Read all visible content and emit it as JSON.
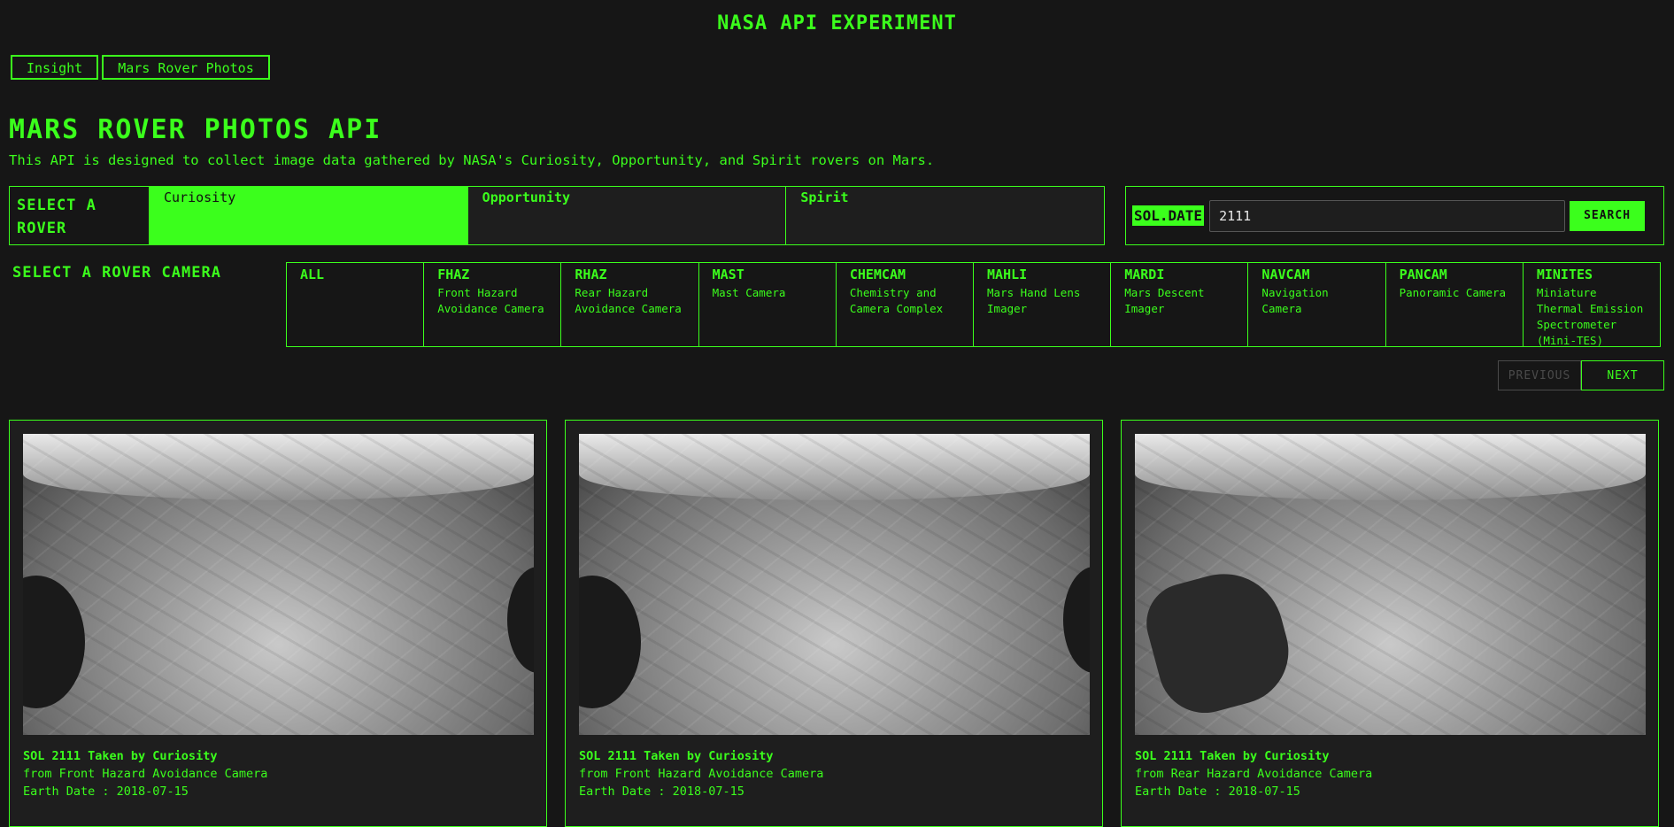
{
  "app_title": "NASA API EXPERIMENT",
  "nav": [
    "Insight",
    "Mars Rover Photos"
  ],
  "page": {
    "title": "MARS ROVER PHOTOS API",
    "description": "This API is designed to collect image data gathered by NASA's Curiosity, Opportunity, and Spirit rovers on Mars."
  },
  "rover_select": {
    "label": "SELECT A ROVER",
    "options": [
      "Curiosity",
      "Opportunity",
      "Spirit"
    ],
    "selected": "Curiosity"
  },
  "search": {
    "label": "SOL.DATE",
    "value": "2111",
    "button": "SEARCH"
  },
  "camera_select": {
    "label": "SELECT A ROVER CAMERA",
    "cameras": [
      {
        "code": "ALL",
        "name": ""
      },
      {
        "code": "FHAZ",
        "name": "Front Hazard Avoidance Camera"
      },
      {
        "code": "RHAZ",
        "name": "Rear Hazard Avoidance Camera"
      },
      {
        "code": "MAST",
        "name": "Mast Camera"
      },
      {
        "code": "CHEMCAM",
        "name": "Chemistry and Camera Complex"
      },
      {
        "code": "MAHLI",
        "name": "Mars Hand Lens Imager"
      },
      {
        "code": "MARDI",
        "name": "Mars Descent Imager"
      },
      {
        "code": "NAVCAM",
        "name": "Navigation Camera"
      },
      {
        "code": "PANCAM",
        "name": "Panoramic Camera"
      },
      {
        "code": "MINITES",
        "name": "Miniature Thermal Emission Spectrometer (Mini-TES)"
      }
    ]
  },
  "pagination": {
    "previous": "PREVIOUS",
    "next": "NEXT"
  },
  "photos": [
    {
      "title": "SOL 2111 Taken by Curiosity",
      "camera": "from Front Hazard Avoidance Camera",
      "earth_date": "Earth Date : 2018-07-15"
    },
    {
      "title": "SOL 2111 Taken by Curiosity",
      "camera": "from Front Hazard Avoidance Camera",
      "earth_date": "Earth Date : 2018-07-15"
    },
    {
      "title": "SOL 2111 Taken by Curiosity",
      "camera": "from Rear Hazard Avoidance Camera",
      "earth_date": "Earth Date : 2018-07-15"
    }
  ],
  "colors": {
    "accent": "#3bff1c",
    "background": "#161616",
    "panel": "#1e1e1e"
  }
}
